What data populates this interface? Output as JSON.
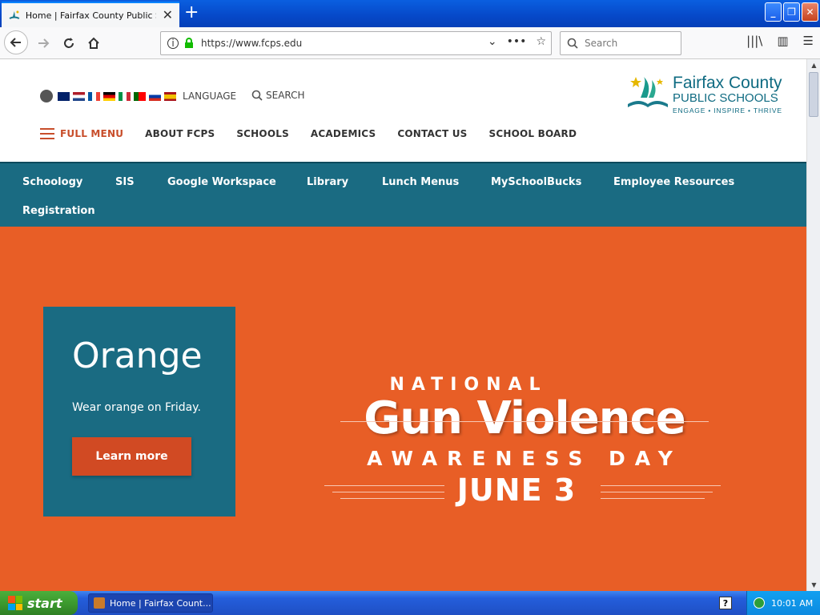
{
  "browser": {
    "tab_title": "Home | Fairfax County Public Schools",
    "url": "https://www.fcps.edu",
    "search_placeholder": "Search"
  },
  "site": {
    "language_label": "LANGUAGE",
    "search_label": "SEARCH",
    "main_nav": [
      "FULL MENU",
      "ABOUT FCPS",
      "SCHOOLS",
      "ACADEMICS",
      "CONTACT US",
      "SCHOOL BOARD"
    ],
    "logo": {
      "name": "Fairfax County",
      "subtitle": "PUBLIC SCHOOLS",
      "tagline": "ENGAGE • INSPIRE • THRIVE"
    },
    "quick_links": [
      "Schoology",
      "SIS",
      "Google Workspace",
      "Library",
      "Lunch Menus",
      "MySchoolBucks",
      "Employee Resources",
      "Registration"
    ]
  },
  "hero": {
    "card_title": "Orange",
    "card_text": "Wear orange on Friday.",
    "card_button": "Learn more",
    "banner_line1": "NATIONAL",
    "banner_line2": "Gun Violence",
    "banner_line3": "AWARENESS DAY",
    "banner_line4": "JUNE 3",
    "bg_color": "#e85e26",
    "card_color": "#1a6b82",
    "button_color": "#d14a23"
  },
  "taskbar": {
    "start_label": "start",
    "task_label": "Home | Fairfax Count...",
    "help_label": "?",
    "clock": "10:01 AM"
  }
}
